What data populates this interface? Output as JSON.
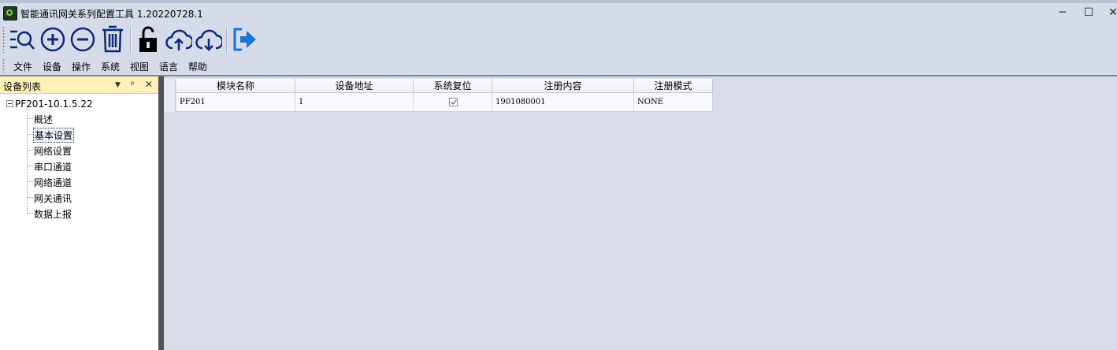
{
  "window": {
    "title": "智能通讯网关系列配置工具 1.20220728.1",
    "minimize": "─",
    "maximize": "☐",
    "close": "✕"
  },
  "toolbar": {
    "buttons": [
      {
        "icon": "search-list-icon",
        "color": "#0a2a7a"
      },
      {
        "icon": "add-icon",
        "color": "#0a2a7a"
      },
      {
        "icon": "remove-icon",
        "color": "#0a2a7a"
      },
      {
        "icon": "delete-icon",
        "color": "#0a2a7a"
      },
      {
        "icon": "unlock-icon",
        "color": "#000000"
      },
      {
        "icon": "cloud-upload-icon",
        "color": "#0a2a7a"
      },
      {
        "icon": "cloud-download-icon",
        "color": "#0a2a7a"
      },
      {
        "icon": "exit-icon",
        "color": "#1a73d9"
      }
    ]
  },
  "menu": {
    "file": "文件",
    "device": "设备",
    "operation": "操作",
    "system": "系统",
    "view": "视图",
    "language": "语言",
    "help": "帮助"
  },
  "device_list": {
    "title": "设备列表",
    "dropdown": "▼",
    "pin": "ᵖ",
    "close": "✕",
    "root": "PF201-10.1.5.22",
    "nodes": [
      "概述",
      "基本设置",
      "网络设置",
      "串口通道",
      "网络通道",
      "网关通讯",
      "数据上报"
    ],
    "selected": "基本设置"
  },
  "grid": {
    "columns": [
      "模块名称",
      "设备地址",
      "系统复位",
      "注册内容",
      "注册模式"
    ],
    "rows": [
      {
        "module_name": "PF201",
        "device_address": "1",
        "system_reset": true,
        "register_content": "1901080001",
        "register_mode": "NONE"
      }
    ]
  }
}
